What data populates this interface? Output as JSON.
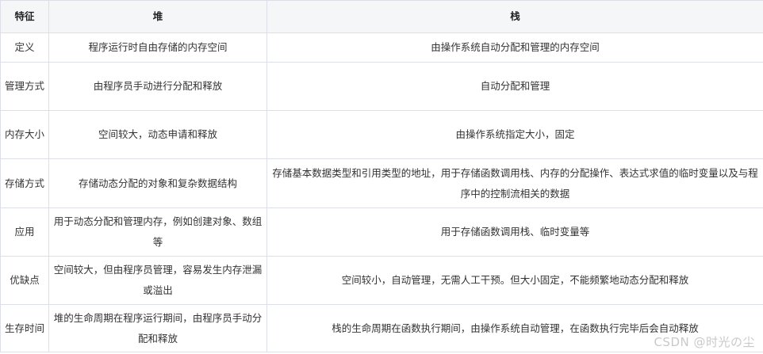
{
  "table": {
    "headers": [
      "特征",
      "堆",
      "栈"
    ],
    "rows": [
      [
        "定义",
        "程序运行时自由存储的内存空间",
        "由操作系统自动分配和管理的内存空间"
      ],
      [
        "管理方式",
        "由程序员手动进行分配和释放",
        "自动分配和管理"
      ],
      [
        "内存大小",
        "空间较大，动态申请和释放",
        "由操作系统指定大小，固定"
      ],
      [
        "存储方式",
        "存储动态分配的对象和复杂数据结构",
        "存储基本数据类型和引用类型的地址，用于存储函数调用栈、内存的分配操作、表达式求值的临时变量以及与程序中的控制流相关的数据"
      ],
      [
        "应用",
        "用于动态分配和管理内存，例如创建对象、数组等",
        "用于存储函数调用栈、临时变量等"
      ],
      [
        "优缺点",
        "空间较大，但由程序员管理，容易发生内存泄漏或溢出",
        "空间较小，自动管理，无需人工干预。但大小固定，不能频繁地动态分配和释放"
      ],
      [
        "生存时间",
        "堆的生命周期在程序运行期间，由程序员手动分配和释放",
        "栈的生命周期在函数执行期间，由操作系统自动管理，在函数执行完毕后会自动释放"
      ]
    ]
  },
  "watermark": "CSDN @时光の尘"
}
